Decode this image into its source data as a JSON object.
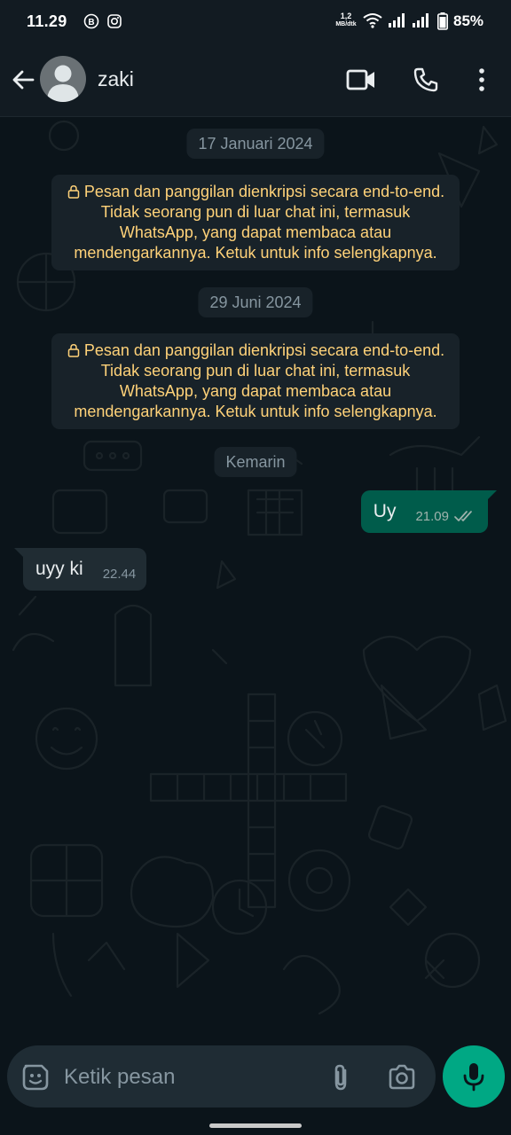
{
  "status_bar": {
    "time": "11.29",
    "speed_value": "1,2",
    "speed_unit": "MB/dtk",
    "battery": "85%"
  },
  "header": {
    "contact_name": "zaki"
  },
  "chat": {
    "date_1": "17 Januari 2024",
    "encryption_notice_1": "Pesan dan panggilan dienkripsi secara end-to-end. Tidak seorang pun di luar chat ini, termasuk WhatsApp, yang dapat membaca atau mendengarkannya. Ketuk untuk info selengkapnya.",
    "date_2": "29 Juni 2024",
    "encryption_notice_2": "Pesan dan panggilan dienkripsi secara end-to-end. Tidak seorang pun di luar chat ini, termasuk WhatsApp, yang dapat membaca atau mendengarkannya. Ketuk untuk info selengkapnya.",
    "date_3": "Kemarin",
    "messages": [
      {
        "direction": "out",
        "text": "Uy",
        "time": "21.09",
        "status": "read"
      },
      {
        "direction": "in",
        "text": "uyy ki",
        "time": "22.44"
      }
    ]
  },
  "compose": {
    "placeholder": "Ketik pesan"
  },
  "colors": {
    "background": "#0b141a",
    "bar": "#121b22",
    "outgoing_bubble": "#005c4b",
    "incoming_bubble": "#202c33",
    "notice_text": "#ffd279",
    "accent": "#00a884"
  },
  "icons": [
    "back-arrow-icon",
    "avatar-icon",
    "video-call-icon",
    "voice-call-icon",
    "more-options-icon",
    "lock-icon",
    "double-check-icon",
    "sticker-icon",
    "paperclip-icon",
    "camera-icon",
    "microphone-icon"
  ]
}
